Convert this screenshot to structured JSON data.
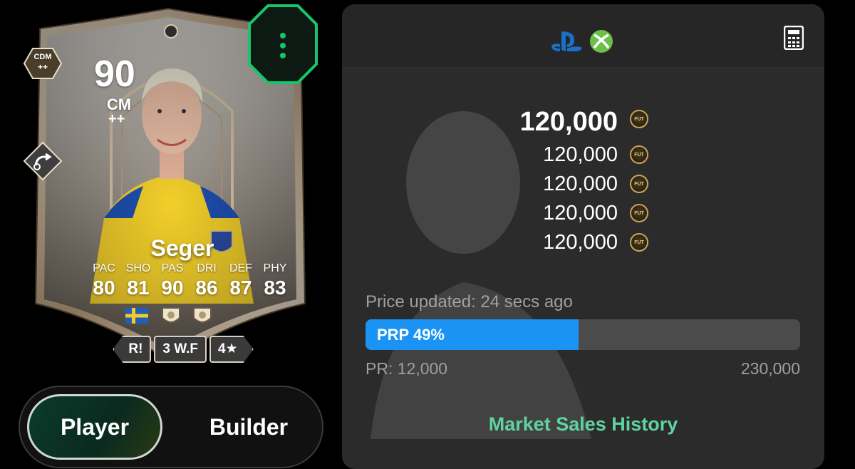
{
  "card": {
    "rating": "90",
    "position": "CM",
    "position_plus": "++",
    "alt_position": "CDM",
    "alt_position_plus": "++",
    "name": "Seger",
    "stats": [
      {
        "label": "PAC",
        "value": "80"
      },
      {
        "label": "SHO",
        "value": "81"
      },
      {
        "label": "PAS",
        "value": "90"
      },
      {
        "label": "DRI",
        "value": "86"
      },
      {
        "label": "DEF",
        "value": "87"
      },
      {
        "label": "PHY",
        "value": "83"
      }
    ],
    "chips": [
      "R!",
      "3 W.F",
      "4★"
    ]
  },
  "toggle": {
    "player": "Player",
    "builder": "Builder"
  },
  "panel": {
    "main_price": "120,000",
    "prices": [
      "120,000",
      "120,000",
      "120,000",
      "120,000"
    ],
    "coin_label": "FUT",
    "updated": "Price updated: 24 secs ago",
    "prp_label": "PRP 49%",
    "prp_percent": 49,
    "pr_min": "PR: 12,000",
    "pr_max": "230,000",
    "history_link": "Market Sales History"
  },
  "colors": {
    "accent_green": "#5fd3a0",
    "bar_blue": "#1a93f5",
    "menu_green": "#19c46b"
  },
  "icons": [
    "playstation-icon",
    "xbox-icon",
    "calculator-icon",
    "menu-dots-icon",
    "sweden-flag-icon",
    "coin-icon"
  ]
}
